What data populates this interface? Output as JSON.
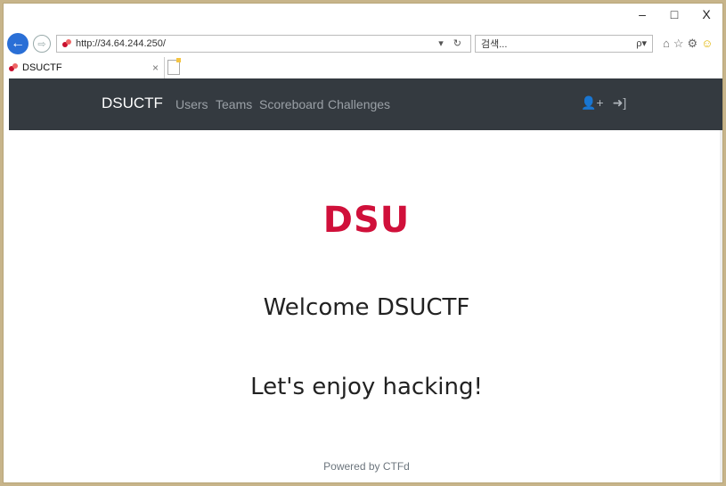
{
  "window": {
    "minimize": "–",
    "maximize": "□",
    "close": "X"
  },
  "toolbar": {
    "url": "http://34.64.244.250/",
    "search_placeholder": "검색...",
    "search_icon_glyph": "ρ▾",
    "addr_controls": "▾ ↻",
    "right_icons": [
      "⌂",
      "☆",
      "⚙",
      "☺"
    ]
  },
  "tab": {
    "title": "DSUCTF",
    "close": "×"
  },
  "nav": {
    "brand": "DSUCTF",
    "links": [
      "Users",
      "Teams",
      "Scoreboard",
      "Challenges"
    ],
    "icons": [
      "👤+",
      "➜]"
    ]
  },
  "main": {
    "logo_text": "DSU",
    "welcome": "Welcome DSUCTF",
    "tagline": "Let's enjoy hacking!"
  },
  "footer": {
    "text": "Powered by CTFd"
  },
  "colors": {
    "navbar": "#343a40",
    "brand_red": "#d0103a",
    "link": "#9aa0a6"
  }
}
